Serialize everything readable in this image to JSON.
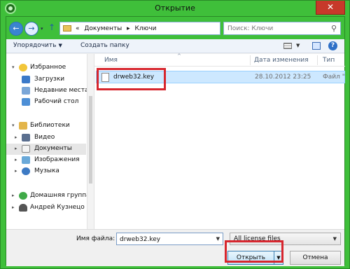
{
  "window": {
    "title": "Открытие",
    "close_glyph": "✕"
  },
  "address": {
    "back_glyph": "←",
    "forward_glyph": "→",
    "dropdown_glyph": "▾",
    "up_glyph": "↑",
    "prefix": "«",
    "crumbs": [
      "Документы",
      "Ключи"
    ],
    "separator": "▸",
    "refresh_glyph": "↻"
  },
  "search": {
    "placeholder": "Поиск: Ключи",
    "icon_glyph": "⚲"
  },
  "toolbar": {
    "organize_label": "Упорядочить",
    "organize_arrow": "▼",
    "new_folder_label": "Создать папку",
    "view_dd_glyph": "▼",
    "help_glyph": "?"
  },
  "nav": {
    "favorites": "Избранное",
    "downloads": "Загрузки",
    "recent": "Недавние места",
    "desktop": "Рабочий стол",
    "libraries": "Библиотеки",
    "video": "Видео",
    "documents": "Документы",
    "images": "Изображения",
    "music": "Музыка",
    "homegroup": "Домашняя группа",
    "user": "Андрей Кузнецо",
    "tri_glyph": "▸",
    "tri_open_glyph": "▾"
  },
  "columns": {
    "name": "Имя",
    "date": "Дата изменения",
    "type": "Тип",
    "sort_glyph": "^"
  },
  "files": [
    {
      "name": "drweb32.key",
      "date": "28.10.2012 23:25",
      "type": "Файл \"KE"
    }
  ],
  "bottom": {
    "filename_label": "Имя файла:",
    "filename_value": "drweb32.key",
    "filename_dd_glyph": "▼",
    "filetype_value": "All license files",
    "filetype_dd_glyph": "▼",
    "open_label": "Открыть",
    "open_split_glyph": "▼",
    "cancel_label": "Отмена"
  },
  "colors": {
    "window_frame": "#3fbf3a",
    "highlight_box": "#d7262e",
    "selection": "#cde8ff"
  }
}
